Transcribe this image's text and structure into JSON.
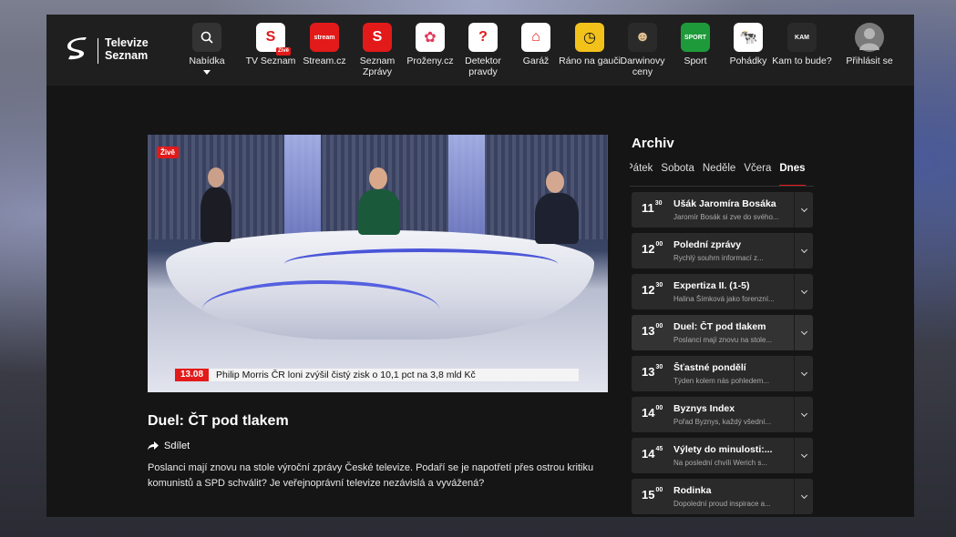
{
  "brand": {
    "name": "Televize\nSeznam"
  },
  "nav": {
    "menu_label": "Nabídka",
    "items": [
      {
        "label": "TV Seznam",
        "badge": "Živě",
        "color": "#ffffff",
        "fg": "#e21a1a",
        "glyph": "S"
      },
      {
        "label": "Stream.cz",
        "color": "#e21a1a",
        "fg": "#ffffff",
        "glyph": "stream"
      },
      {
        "label": "Seznam Zprávy",
        "color": "#e21a1a",
        "fg": "#ffffff",
        "glyph": "S"
      },
      {
        "label": "Proženy.cz",
        "color": "#ffffff",
        "fg": "#e2385a",
        "glyph": "✿"
      },
      {
        "label": "Detektor pravdy",
        "color": "#ffffff",
        "fg": "#e21a1a",
        "glyph": "?"
      },
      {
        "label": "Garáž",
        "color": "#ffffff",
        "fg": "#e21a1a",
        "glyph": "⌂"
      },
      {
        "label": "Ráno na gauči",
        "color": "#f2c21b",
        "fg": "#111111",
        "glyph": "◷"
      },
      {
        "label": "Darwinovy ceny",
        "color": "#2a2a2a",
        "fg": "#e0c090",
        "glyph": "☻"
      },
      {
        "label": "Sport",
        "color": "#1e9a3a",
        "fg": "#ffffff",
        "glyph": "SPORT"
      },
      {
        "label": "Pohádky",
        "color": "#ffffff",
        "fg": "#111111",
        "glyph": "🐄"
      },
      {
        "label": "Kam to bude?",
        "color": "#2a2a2a",
        "fg": "#ffffff",
        "glyph": "KAM"
      }
    ],
    "login_label": "Přihlásit se"
  },
  "player": {
    "live_tag": "Živě",
    "ticker_time": "13.08",
    "ticker_text": "Philip Morris ČR loni zvýšil čistý zisk o 10,1 pct na 3,8 mld Kč"
  },
  "show": {
    "title": "Duel: ČT pod tlakem",
    "share_label": "Sdílet",
    "description": "Poslanci mají znovu na stole výroční zprávy České televize. Podaří se je napotřetí přes ostrou kritiku komunistů a SPD schválit? Je veřejnoprávní televize nezávislá a vyvážená?"
  },
  "archive": {
    "title": "Archiv",
    "tabs": [
      "Pátek",
      "Sobota",
      "Neděle",
      "Včera",
      "Dnes"
    ],
    "active_tab": 4,
    "items": [
      {
        "hour": "11",
        "min": "30",
        "name": "Ušák Jaromíra Bosáka",
        "desc": "Jaromír Bosák si zve do svého..."
      },
      {
        "hour": "12",
        "min": "00",
        "name": "Polední zprávy",
        "desc": "Rychlý souhrn informací z..."
      },
      {
        "hour": "12",
        "min": "30",
        "name": "Expertiza II. (1-5)",
        "desc": "Halina Šímková jako forenzní..."
      },
      {
        "hour": "13",
        "min": "00",
        "name": "Duel: ČT pod tlakem",
        "desc": "Poslanci mají znovu na stole...",
        "current": true
      },
      {
        "hour": "13",
        "min": "30",
        "name": "Šťastné pondělí",
        "desc": "Týden kolem nás pohledem..."
      },
      {
        "hour": "14",
        "min": "00",
        "name": "Byznys Index",
        "desc": "Pořad Byznys, každý všední..."
      },
      {
        "hour": "14",
        "min": "45",
        "name": "Výlety do minulosti:...",
        "desc": "Na poslední chvíli Werich s..."
      },
      {
        "hour": "15",
        "min": "00",
        "name": "Rodinka",
        "desc": "Dopolední proud inspirace a..."
      }
    ]
  }
}
